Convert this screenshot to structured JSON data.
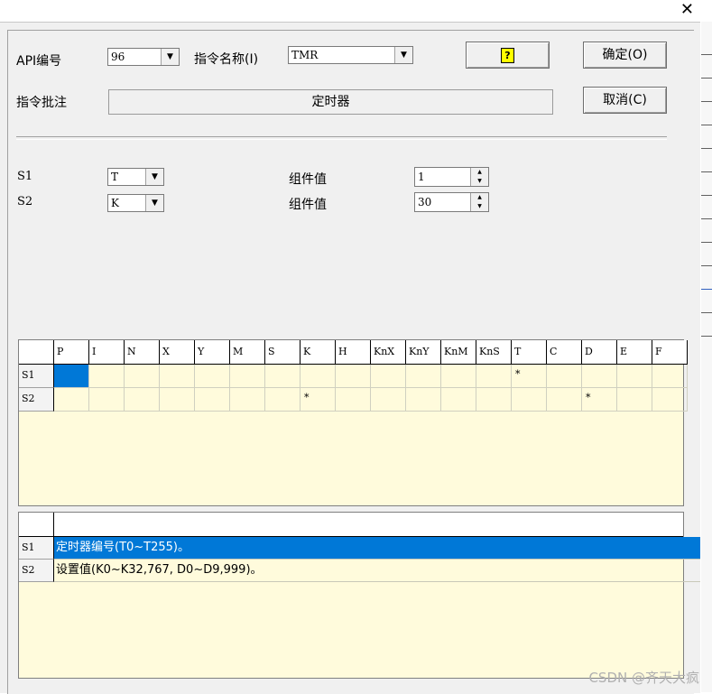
{
  "window": {
    "close_glyph": "✕"
  },
  "form": {
    "api_label": "API编号",
    "api_value": "96",
    "name_label": "指令名称(I)",
    "name_value": "TMR",
    "note_label": "指令批注",
    "note_value": "定时器",
    "help_button": "?",
    "ok_button": "确定(O)",
    "cancel_button": "取消(C)"
  },
  "operands": [
    {
      "label": "S1",
      "type": "T",
      "value_label": "组件值",
      "value": "1"
    },
    {
      "label": "S2",
      "type": "K",
      "value_label": "组件值",
      "value": "30"
    }
  ],
  "device_table": {
    "columns": [
      "P",
      "I",
      "N",
      "X",
      "Y",
      "M",
      "S",
      "K",
      "H",
      "KnX",
      "KnY",
      "KnM",
      "KnS",
      "T",
      "C",
      "D",
      "E",
      "F"
    ],
    "rows": [
      {
        "label": "S1",
        "marks": [
          "",
          "",
          "",
          "",
          "",
          "",
          "",
          "",
          "",
          "",
          "",
          "",
          "",
          "*",
          "",
          "",
          "",
          ""
        ]
      },
      {
        "label": "S2",
        "marks": [
          "",
          "",
          "",
          "",
          "",
          "",
          "",
          "*",
          "",
          "",
          "",
          "",
          "",
          "",
          "",
          "*",
          "",
          ""
        ]
      }
    ]
  },
  "desc_table": {
    "rows": [
      {
        "label": "S1",
        "text": "定时器编号(T0~T255)。"
      },
      {
        "label": "S2",
        "text": "设置值(K0~K32,767, D0~D9,999)。"
      }
    ]
  },
  "watermark": "CSDN @齐天大疯",
  "colors": {
    "selection": "#0078d7",
    "grid_bg": "#fffbdc",
    "dialog_bg": "#f0f0f0",
    "help_icon": "#ffff00"
  }
}
